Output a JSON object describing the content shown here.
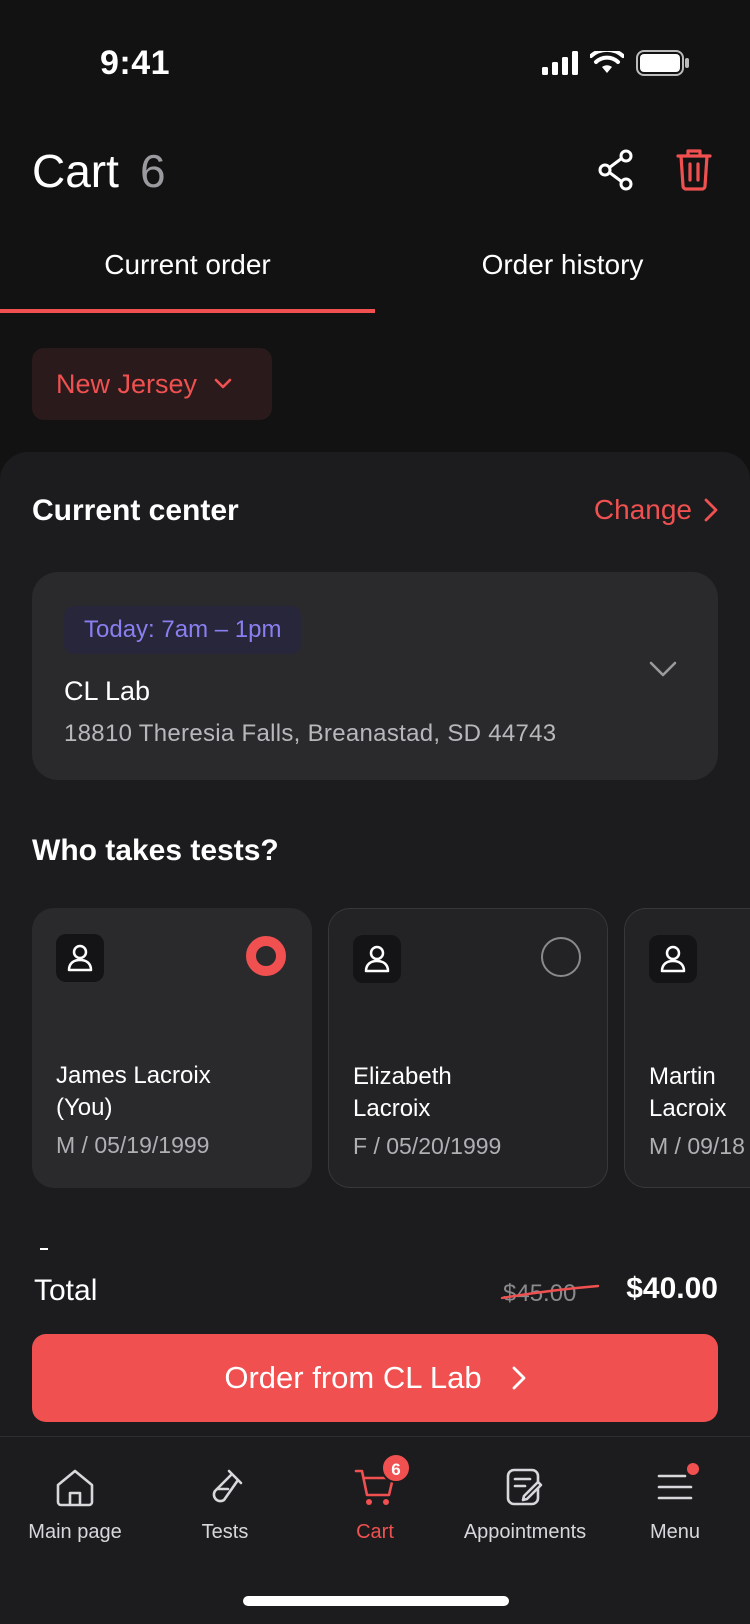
{
  "status_bar": {
    "time": "9:41"
  },
  "header": {
    "title": "Cart",
    "count": "6"
  },
  "tabs": [
    {
      "label": "Current order",
      "active": true
    },
    {
      "label": "Order history",
      "active": false
    }
  ],
  "state_select": {
    "value": "New Jersey"
  },
  "current_center": {
    "section_title": "Current center",
    "change_label": "Change",
    "hours": "Today: 7am – 1pm",
    "name": "CL Lab",
    "address": "18810 Theresia Falls, Breanastad, SD 44743"
  },
  "who_takes": {
    "title": "Who takes tests?",
    "patients": [
      {
        "name_line1": "James Lacroix",
        "name_line2": "(You)",
        "info": "M / 05/19/1999",
        "selected": true
      },
      {
        "name_line1": "Elizabeth",
        "name_line2": "Lacroix",
        "info": "F / 05/20/1999",
        "selected": false
      },
      {
        "name_line1": "Martin",
        "name_line2": "Lacroix",
        "info": "M / 09/18",
        "selected": false
      }
    ]
  },
  "total": {
    "label": "Total",
    "old_price": "$45.00",
    "new_price": "$40.00"
  },
  "order_button": {
    "label": "Order from CL Lab"
  },
  "tabbar": {
    "items": [
      {
        "label": "Main page",
        "icon": "home-icon"
      },
      {
        "label": "Tests",
        "icon": "test-tube-icon"
      },
      {
        "label": "Cart",
        "icon": "cart-icon",
        "badge": "6",
        "active": true
      },
      {
        "label": "Appointments",
        "icon": "appointments-icon"
      },
      {
        "label": "Menu",
        "icon": "menu-icon"
      }
    ]
  },
  "colors": {
    "accent": "#f05150",
    "background": "#121213",
    "sheet": "#1c1c1e",
    "card": "#2a2a2d",
    "badge_purple": "#8a7ff0"
  }
}
